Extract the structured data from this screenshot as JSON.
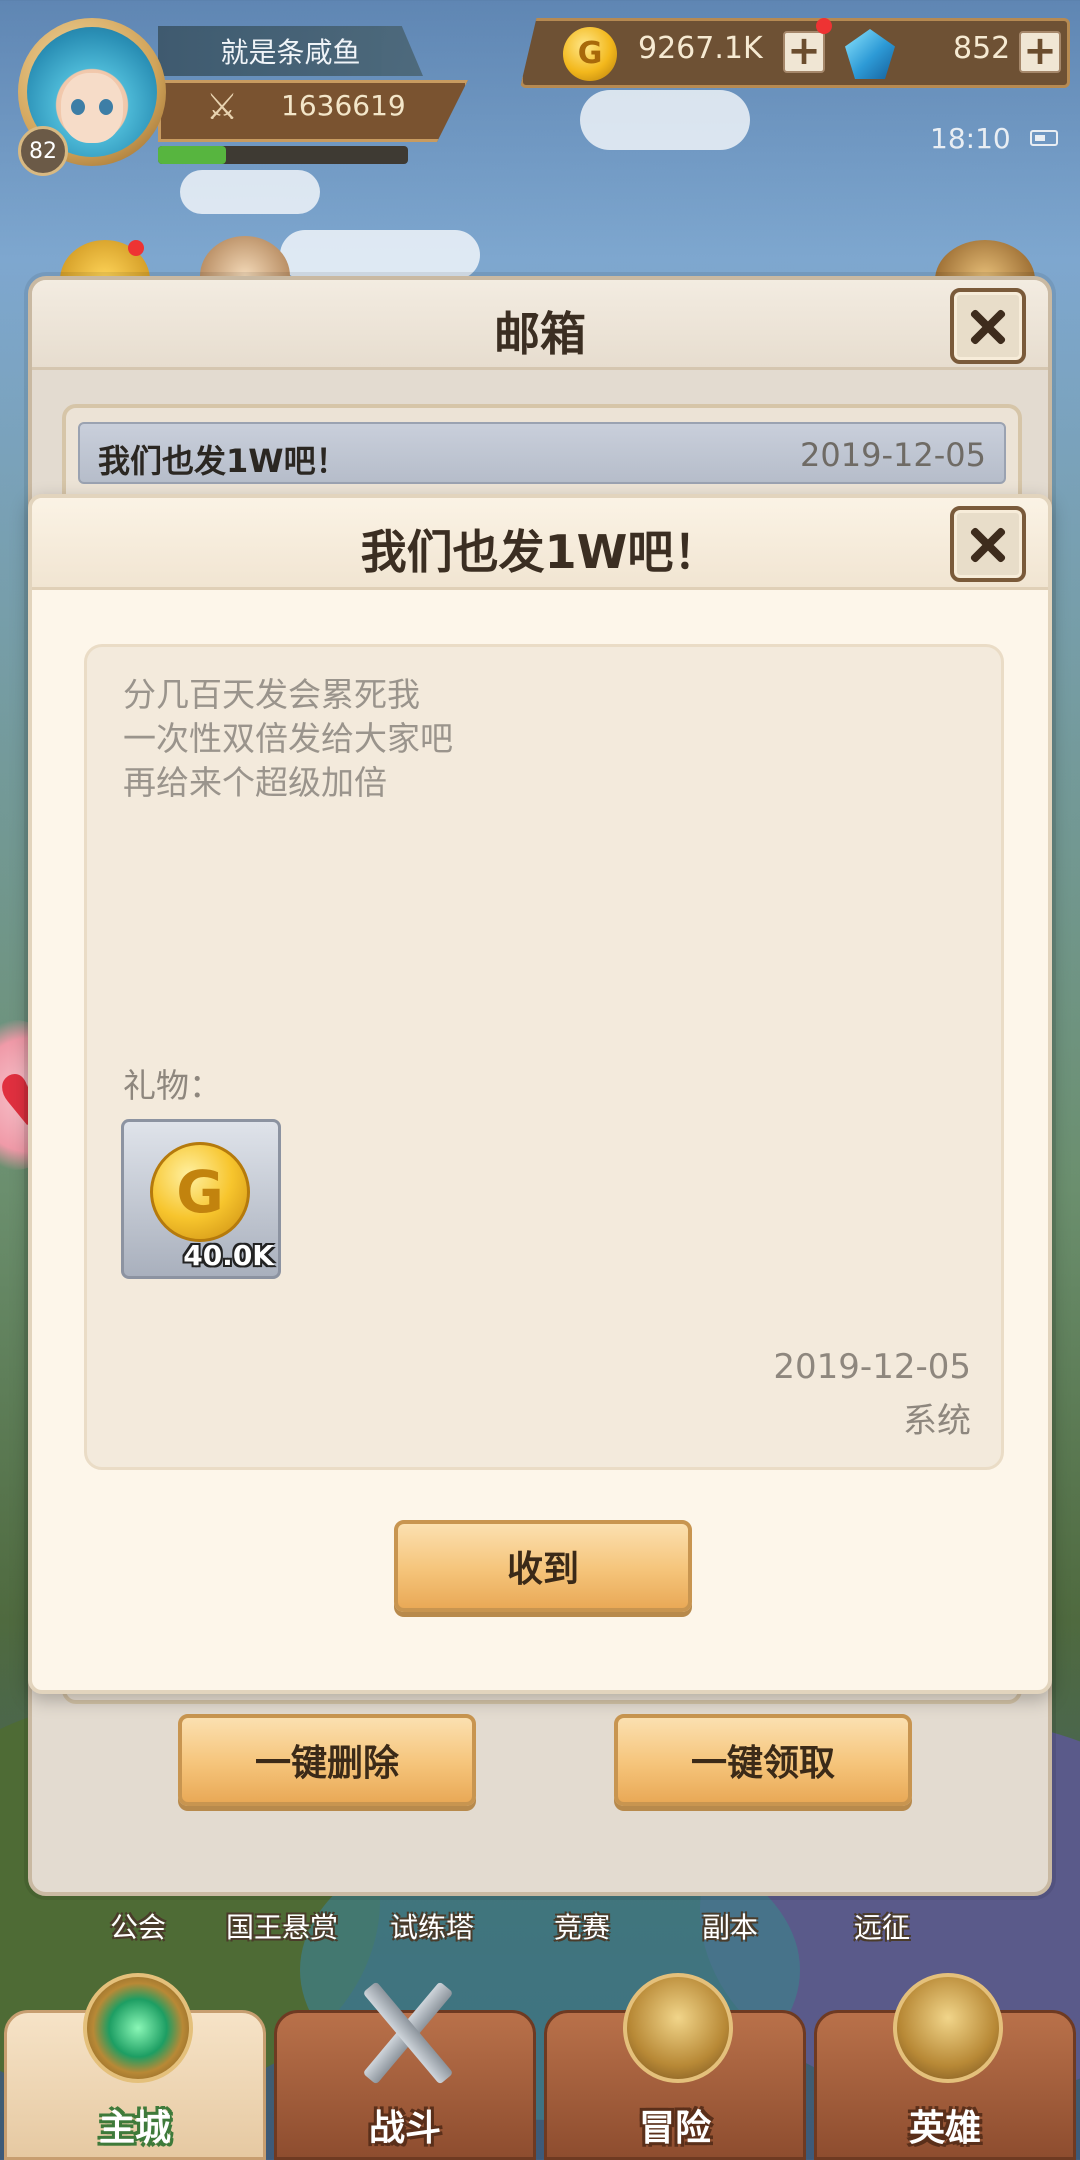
{
  "player": {
    "name": "就是条咸鱼",
    "level": "82",
    "power": "1636619",
    "exp_progress": 0.27
  },
  "resources": {
    "gold": "9267.1K",
    "gems": "852",
    "gold_icon_glyph": "G"
  },
  "status": {
    "time": "18:10"
  },
  "mailbox": {
    "title": "邮箱",
    "list": [
      {
        "title": "我们也发1W吧！",
        "date": "2019-12-05"
      }
    ],
    "delete_all_label": "一键删除",
    "claim_all_label": "一键领取"
  },
  "letter": {
    "title": "我们也发1W吧！",
    "body": "分几百天发会累死我\n一次性双倍发给大家吧\n再给来个超级加倍",
    "gift_label": "礼物：",
    "gift": {
      "icon": "gold-coin-icon",
      "glyph": "G",
      "amount": "40.0K"
    },
    "date": "2019-12-05",
    "sender": "系统",
    "receive_label": "收到"
  },
  "feature_row": [
    "公会",
    "国王悬赏",
    "试练塔",
    "竞赛",
    "副本",
    "远征"
  ],
  "bottom_nav": [
    {
      "label": "主城",
      "active": true
    },
    {
      "label": "战斗",
      "active": false
    },
    {
      "label": "冒险",
      "active": false
    },
    {
      "label": "英雄",
      "active": false
    }
  ],
  "colors": {
    "panel_bg": "#fdf6ea",
    "button_orange": "#f5c47a",
    "nav_brown": "#8e4d2f",
    "active_tab": "#e6c9a2"
  }
}
